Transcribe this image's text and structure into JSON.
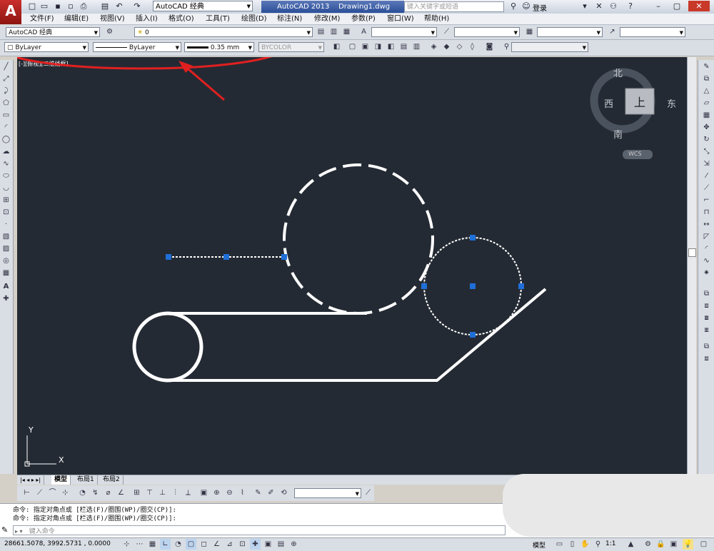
{
  "app": {
    "logo_letter": "A",
    "workspace": "AutoCAD 经典",
    "title": "AutoCAD 2013",
    "filename": "Drawing1.dwg",
    "search_placeholder": "键入关键字或短语",
    "login": "登录"
  },
  "menu": [
    "文件(F)",
    "编辑(E)",
    "视图(V)",
    "插入(I)",
    "格式(O)",
    "工具(T)",
    "绘图(D)",
    "标注(N)",
    "修改(M)",
    "参数(P)",
    "窗口(W)",
    "帮助(H)"
  ],
  "toolbar1": {
    "workspace": "AutoCAD 经典",
    "layer": "0"
  },
  "properties": {
    "color": "ByLayer",
    "linetype": "ByLayer",
    "lineweight": "0.35 mm",
    "plotstyle": "BYCOLOR"
  },
  "viewport_label": "[-][俯视][二维线框]",
  "viewcube": {
    "north": "北",
    "south": "南",
    "east": "东",
    "west": "西",
    "top": "上",
    "wcs": "WCS"
  },
  "ucs": {
    "x": "X",
    "y": "Y"
  },
  "tabs": [
    "模型",
    "布局1",
    "布局2"
  ],
  "command": {
    "lines": [
      "命令: 指定对角点或 [栏选(F)/圈围(WP)/圈交(CP)]:",
      "命令: 指定对角点或 [栏选(F)/圈围(WP)/圈交(CP)]:"
    ],
    "prompt": "键入命令"
  },
  "status": {
    "coords": "28661.5078, 3992.5731 , 0.0000",
    "model": "模型",
    "scale": "1:1"
  },
  "colors": {
    "canvas": "#242a33",
    "grip": "#1f6fd8",
    "annotation": "#e02020"
  }
}
